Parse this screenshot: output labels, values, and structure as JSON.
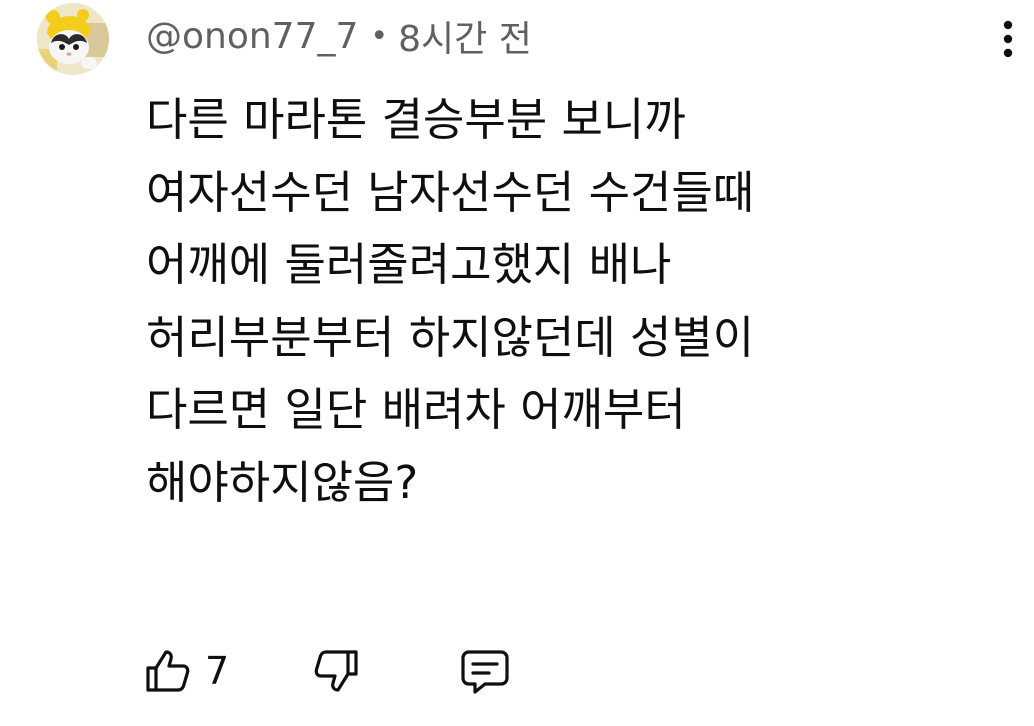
{
  "comment": {
    "author": "@onon77_7",
    "separator": "•",
    "time": "8시간 전",
    "lines": [
      "다른 마라톤 결승부분 보니까",
      "여자선수던 남자선수던 수건들때",
      "어깨에 둘러줄려고했지 배나",
      "허리부분부터 하지않던데 성별이",
      "다르면 일단 배려차 어깨부터",
      "해야하지않음?"
    ],
    "actions": {
      "like_count": "7"
    }
  },
  "icons": {
    "avatar": "cat-in-yellow-hat-avatar",
    "menu": "more-vertical-icon",
    "like": "thumbs-up-icon",
    "dislike": "thumbs-down-icon",
    "reply": "comment-icon"
  },
  "colors": {
    "text": "#0f0f0f",
    "secondary_text": "#606060",
    "background": "#ffffff"
  }
}
